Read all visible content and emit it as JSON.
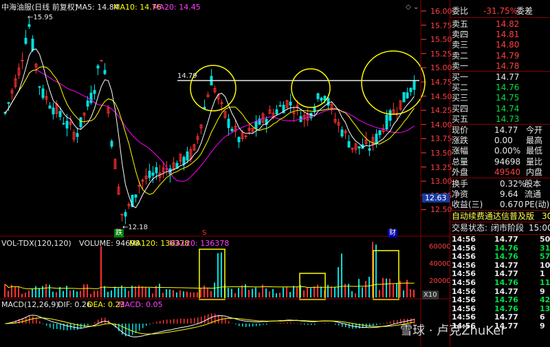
{
  "chart_title": "中海油服(日线 前复权)",
  "ma": {
    "ma5_label": "MA5: 14.84",
    "ma10_label": "MA10: 14.76",
    "ma20_label": "MA20: 14.45"
  },
  "colors": {
    "up": "#ff3030",
    "down": "#00e0e0",
    "ma5": "#ffffff",
    "ma10": "#ffff00",
    "ma20": "#ff00ff",
    "grid": "#7a0000",
    "text": "#c8c8c8"
  },
  "price_axis": [
    "16.00",
    "15.75",
    "15.50",
    "15.25",
    "15.00",
    "14.75",
    "14.50",
    "14.25",
    "14.00",
    "13.75",
    "13.50",
    "13.25",
    "13.00",
    "12.75",
    "12.50"
  ],
  "price_current_tag": "12.63",
  "annotations": {
    "high": "15.95",
    "low": "12.18",
    "resistance": "14.79"
  },
  "markers": {
    "die": "跌",
    "s": "S",
    "cai": "财"
  },
  "volume": {
    "title": "VOL-TDX(120,120)",
    "vol": "VOLUME: 94698",
    "ma120a": "MA120: 136378",
    "ma120b": "MA120: 136378",
    "axis": [
      "60000",
      "40000",
      "20000"
    ],
    "unit": "X10"
  },
  "macd": {
    "title": "MACD(12,26,9)",
    "dif": "DIF: 0.26",
    "dea": "DEA: 0.23",
    "macd": "MACD: 0.05"
  },
  "order_book": {
    "header": "委比",
    "header_value": "-31.75%",
    "header_tail": "委差",
    "asks": [
      {
        "label": "卖五",
        "price": "14.82"
      },
      {
        "label": "卖四",
        "price": "14.81"
      },
      {
        "label": "卖三",
        "price": "14.80"
      },
      {
        "label": "卖二",
        "price": "14.79"
      },
      {
        "label": "卖一",
        "price": "14.78"
      }
    ],
    "bids": [
      {
        "label": "买一",
        "price": "14.77"
      },
      {
        "label": "买二",
        "price": "14.76"
      },
      {
        "label": "买三",
        "price": "14.75"
      },
      {
        "label": "买四",
        "price": "14.74"
      },
      {
        "label": "买五",
        "price": "14.73"
      }
    ]
  },
  "quote": [
    {
      "l": "现价",
      "v": "14.77",
      "r": "今开"
    },
    {
      "l": "涨跌",
      "v": "0.00",
      "r": "最高"
    },
    {
      "l": "涨幅",
      "v": "0.00%",
      "r": "最低"
    },
    {
      "l": "总量",
      "v": "94698",
      "r": "量比"
    },
    {
      "l": "外盘",
      "v": "49540",
      "r": "内盘"
    }
  ],
  "stats": [
    {
      "l": "换手",
      "v": "0.32%",
      "r": "股本"
    },
    {
      "l": "净资",
      "v": "9.64",
      "r": "流通"
    },
    {
      "l": "收益(三)",
      "v": "0.670",
      "r": "PE(动)"
    }
  ],
  "notice": "自动续费通达信普及版",
  "notice_tail": "30",
  "trade_status": {
    "label": "交易状态:",
    "value": "闭市阶段",
    "time": "15:00"
  },
  "ticks": [
    {
      "t": "14:56",
      "p": "14.77",
      "v": "50"
    },
    {
      "t": "14:56",
      "p": "14.76",
      "v": "31"
    },
    {
      "t": "14:56",
      "p": "14.76",
      "v": "57"
    },
    {
      "t": "14:56",
      "p": "14.77",
      "v": "10"
    },
    {
      "t": "14:56",
      "p": "14.77",
      "v": "1"
    },
    {
      "t": "14:56",
      "p": "14.76",
      "v": "11"
    },
    {
      "t": "14:56",
      "p": "14.77",
      "v": "9"
    },
    {
      "t": "14:56",
      "p": "14.76",
      "v": "42"
    },
    {
      "t": "14:56",
      "p": "14.76",
      "v": "13"
    },
    {
      "t": "14:56",
      "p": "14.77",
      "v": "6"
    },
    {
      "t": "14:56",
      "p": "14.77",
      "v": "9"
    }
  ],
  "watermark": "雪球 · 卢克ZhuKer",
  "toolbar_icons": [
    "diamond-icon",
    "chevron-down-icon"
  ]
}
